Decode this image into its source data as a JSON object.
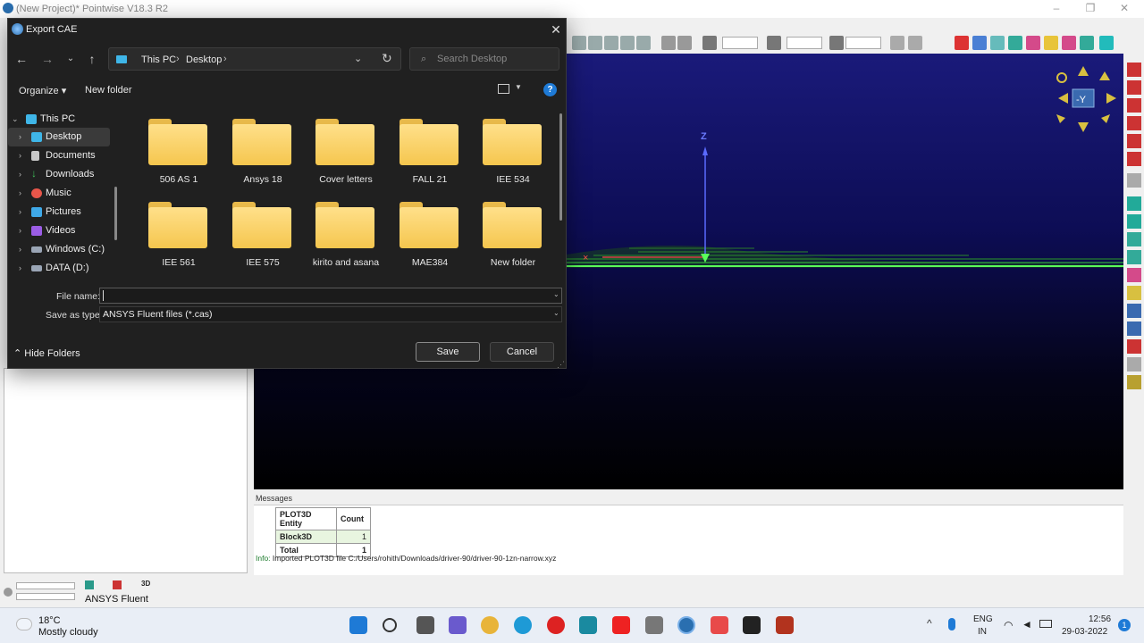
{
  "app": {
    "title": "(New Project)* Pointwise V18.3 R2",
    "solver_label": "ANSYS Fluent"
  },
  "viewport": {
    "axis_label": "Z",
    "view_label": "-Y"
  },
  "messages": {
    "title": "Messages",
    "table_headers": [
      "PLOT3D Entity",
      "Count"
    ],
    "rows": [
      {
        "entity": "Block3D",
        "count": "1"
      },
      {
        "entity": "Total",
        "count": "1"
      }
    ],
    "info_prefix": "Info:",
    "info_text": "Imported PLOT3D file C:/Users/rohith/Downloads/driver-90/driver-90-1zn-narrow.xyz"
  },
  "dialog": {
    "title": "Export CAE",
    "breadcrumbs": [
      "This PC",
      "Desktop"
    ],
    "search_placeholder": "Search Desktop",
    "organize_label": "Organize",
    "new_folder_label": "New folder",
    "nav_items": [
      {
        "label": "This PC",
        "icon": "computer-icon",
        "color": "#3fb6e8"
      },
      {
        "label": "Desktop",
        "icon": "desktop-icon",
        "color": "#3fb6e8"
      },
      {
        "label": "Documents",
        "icon": "documents-icon",
        "color": "#c8c8c8"
      },
      {
        "label": "Downloads",
        "icon": "downloads-icon",
        "color": "#3fbf5a"
      },
      {
        "label": "Music",
        "icon": "music-icon",
        "color": "#e8564a"
      },
      {
        "label": "Pictures",
        "icon": "pictures-icon",
        "color": "#3fa9e8"
      },
      {
        "label": "Videos",
        "icon": "videos-icon",
        "color": "#9b5de5"
      },
      {
        "label": "Windows (C:)",
        "icon": "drive-icon",
        "color": "#9aa5b5"
      },
      {
        "label": "DATA (D:)",
        "icon": "drive-icon",
        "color": "#9aa5b5"
      }
    ],
    "folders": [
      "506 AS 1",
      "Ansys 18",
      "Cover letters",
      "FALL 21",
      "IEE 534",
      "IEE 561",
      "IEE 575",
      "kirito and asana",
      "MAE384",
      "New folder"
    ],
    "file_name_label": "File name:",
    "file_name_value": "",
    "save_as_type_label": "Save as type:",
    "save_as_type_value": "ANSYS Fluent files (*.cas)",
    "hide_folders_label": "Hide Folders",
    "save_label": "Save",
    "cancel_label": "Cancel"
  },
  "taskbar": {
    "temperature": "18°C",
    "weather": "Mostly cloudy",
    "lang_line1": "ENG",
    "lang_line2": "IN",
    "time": "12:56",
    "date": "29-03-2022"
  }
}
